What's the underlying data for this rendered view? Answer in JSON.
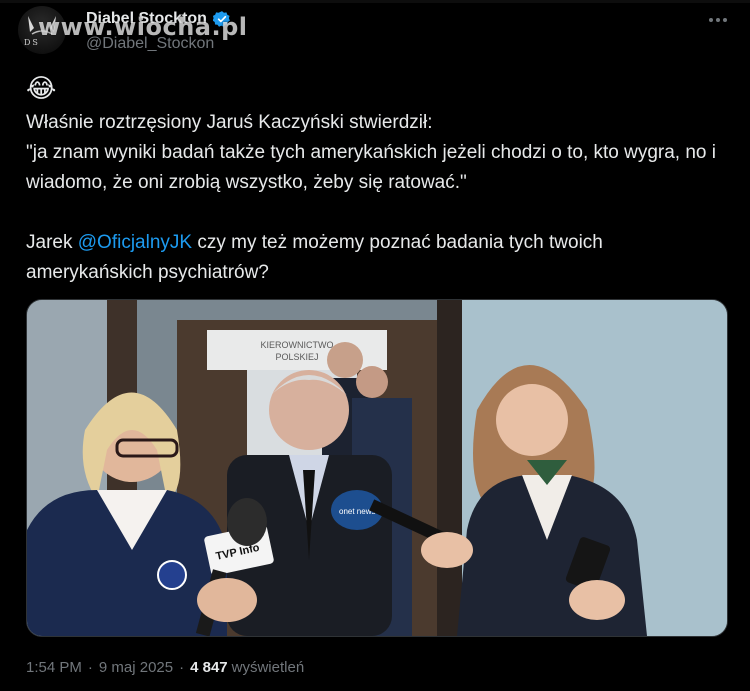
{
  "post": {
    "author": {
      "display_name": "Diabel Stockton",
      "handle": "@Diabel_Stockon",
      "verified": true,
      "avatar_text": "DS"
    },
    "watermark": "www.wiocha.pl",
    "emoji": "😂",
    "text_lines": [
      "Właśnie roztrzęsiony Jaruś Kaczyński stwierdził:",
      "\"ja znam wyniki badań także tych amerykańskich jeżeli chodzi o to, kto wygra, no i wiadomo, że oni zrobią wszystko, żeby się ratować.\""
    ],
    "reply_prefix": "Jarek ",
    "mention": "@OficjalnyJK",
    "reply_suffix": " czy my też możemy poznać badania tych twoich amerykańskich psychiatrów?",
    "media": {
      "sign_text_1": "KIEROWNICTWO",
      "sign_text_2": "POLSKIEJ",
      "mic_label": "TVP Info",
      "mic2_label": "onet news"
    },
    "time": "1:54 PM",
    "date": "9 maj 2025",
    "views_count": "4 847",
    "views_label": "wyświetleń"
  },
  "colors": {
    "background": "#000000",
    "text": "#e7e9ea",
    "muted": "#71767b",
    "link": "#1d9bf0"
  }
}
